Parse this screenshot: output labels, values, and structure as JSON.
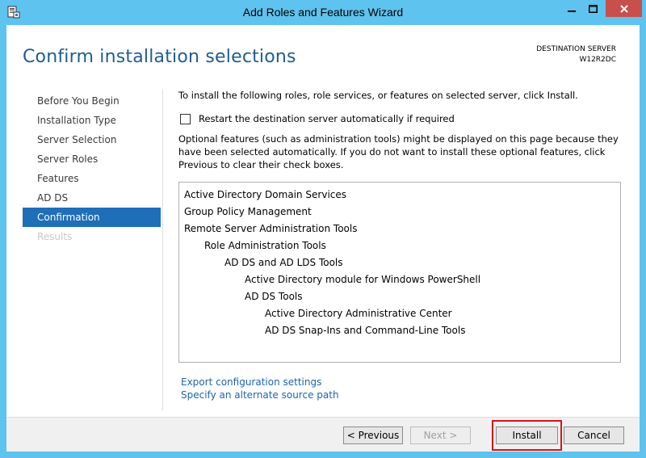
{
  "window": {
    "title": "Add Roles and Features Wizard",
    "accent_color": "#5ec3ee",
    "close_color": "#c7504c"
  },
  "header": {
    "title": "Confirm installation selections",
    "destination_label": "DESTINATION SERVER",
    "destination_server": "W12R2DC"
  },
  "nav": {
    "items": [
      {
        "label": "Before You Begin",
        "state": "normal"
      },
      {
        "label": "Installation Type",
        "state": "normal"
      },
      {
        "label": "Server Selection",
        "state": "normal"
      },
      {
        "label": "Server Roles",
        "state": "normal"
      },
      {
        "label": "Features",
        "state": "normal"
      },
      {
        "label": "AD DS",
        "state": "normal"
      },
      {
        "label": "Confirmation",
        "state": "active"
      },
      {
        "label": "Results",
        "state": "disabled"
      }
    ]
  },
  "main": {
    "intro": "To install the following roles, role services, or features on selected server, click Install.",
    "restart_label": "Restart the destination server automatically if required",
    "restart_checked": false,
    "optional_note": "Optional features (such as administration tools) might be displayed on this page because they have been selected automatically. If you do not want to install these optional features, click Previous to clear their check boxes.",
    "features": [
      {
        "label": "Active Directory Domain Services",
        "level": 0
      },
      {
        "label": "Group Policy Management",
        "level": 0
      },
      {
        "label": "Remote Server Administration Tools",
        "level": 0
      },
      {
        "label": "Role Administration Tools",
        "level": 1
      },
      {
        "label": "AD DS and AD LDS Tools",
        "level": 2
      },
      {
        "label": "Active Directory module for Windows PowerShell",
        "level": 3
      },
      {
        "label": "AD DS Tools",
        "level": 3
      },
      {
        "label": "Active Directory Administrative Center",
        "level": 4
      },
      {
        "label": "AD DS Snap-Ins and Command-Line Tools",
        "level": 4
      }
    ],
    "export_link": "Export configuration settings",
    "alternate_link": "Specify an alternate source path"
  },
  "buttons": {
    "previous": "< Previous",
    "next": "Next >",
    "install": "Install",
    "cancel": "Cancel"
  },
  "icons": {
    "app": "server-manager-icon",
    "minimize": "minimize-icon",
    "maximize": "maximize-icon",
    "close": "close-icon"
  },
  "highlight_color": "#d4141c"
}
